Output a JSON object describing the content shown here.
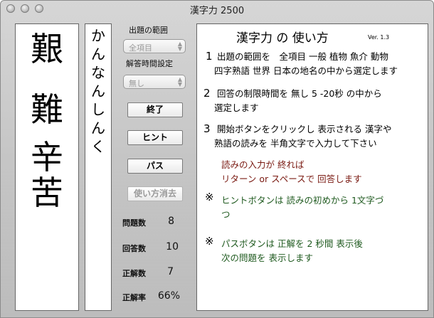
{
  "window": {
    "title": "漢字力 2500"
  },
  "kanji": [
    "艱",
    "難",
    "辛",
    "苦"
  ],
  "reading": [
    "か",
    "ん",
    "な",
    "ん",
    "し",
    "ん",
    "く"
  ],
  "controls": {
    "range_label": "出題の範囲",
    "range_value": "全項目",
    "time_label": "解答時間設定",
    "time_value": "無し",
    "end_button": "終了",
    "hint_button": "ヒント",
    "pass_button": "パス",
    "help_clear_button": "使い方消去"
  },
  "stats": {
    "questions_label": "問題数",
    "questions_value": "8",
    "answers_label": "回答数",
    "answers_value": "10",
    "correct_label": "正解数",
    "correct_value": "7",
    "rate_label": "正解率",
    "rate_value": "66%"
  },
  "help": {
    "title": "漢字力 の 使い方",
    "version": "Ver. 1.3",
    "item1_num": "1",
    "item1_line1": "出題の範囲を　全項目 一般 植物 魚介 動物",
    "item1_line2": "四字熟語 世界 日本の地名の中から選定します",
    "item2_num": "2",
    "item2_line1": "回答の制限時間を 無し 5 -20秒 の中から",
    "item2_line2": "選定します",
    "item3_num": "3",
    "item3_line1": "開始ボタンをクリックし 表示される 漢字や",
    "item3_line2": "熟語の読みを 半角文字で入力して下さい",
    "note_red1": "読みの入力が 終れば",
    "note_red2": "リターン or スペースで 回答します",
    "mark": "※",
    "hint_line1": "ヒントボタンは 読みの初めから 1文字づ",
    "hint_line2": "つ",
    "pass_line1": "パスボタンは 正解を 2 秒間 表示後",
    "pass_line2": "次の問題を 表示します"
  },
  "colors": {
    "red_text": "#7a1a12",
    "green_text": "#1f5a1f"
  }
}
